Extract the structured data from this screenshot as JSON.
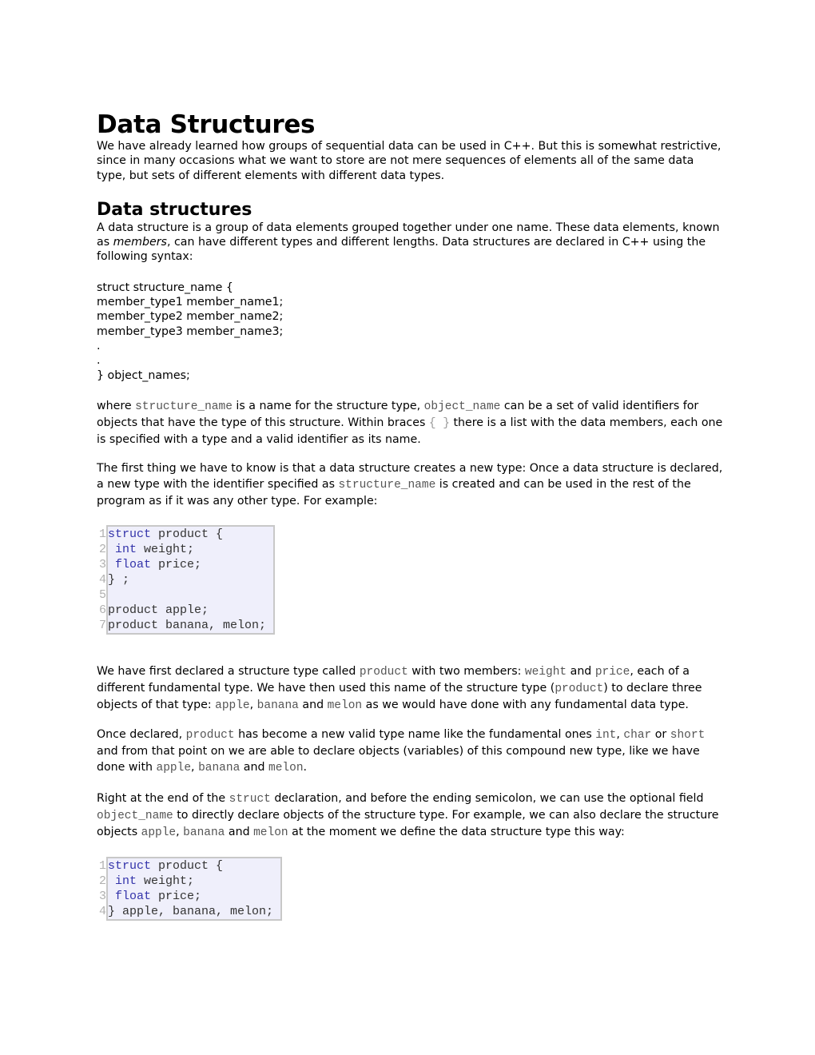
{
  "title": "Data Structures",
  "intro": "We have already learned how groups of sequential data can be used in C++. But this is somewhat restrictive, since in many occasions what we want to store are not mere sequences of elements all of the same data type, but sets of different elements with different data types.",
  "section1": {
    "heading": "Data structures",
    "para_a": "A data structure is a group of data elements grouped together under one name. These data elements, known as ",
    "para_em": "members",
    "para_b": ", can have different types and different lengths. Data structures are declared in C++ using the following syntax:"
  },
  "syntax_lines": [
    "struct structure_name {",
    "member_type1 member_name1;",
    "member_type2 member_name2;",
    "member_type3 member_name3;",
    ".",
    ".",
    "} object_names;"
  ],
  "para_where": {
    "t1": "where ",
    "c1": "structure_name",
    "t2": " is a name for the structure type, ",
    "c2": "object_name",
    "t3": " can be a set of valid identifiers for objects that have the type of this structure. Within braces ",
    "c3": "{ }",
    "t4": " there is a list with the data members, each one is specified with a type and a valid identifier as its name."
  },
  "para_first": {
    "t1": "The first thing we have to know is that a data structure creates a new type: Once a data structure is declared, a new type with the identifier specified as ",
    "c1": "structure_name",
    "t2": " is created and can be used in the rest of the program as if it was any other type. For example:"
  },
  "code1": [
    {
      "num": "1",
      "kw": "struct",
      "rest": " product {"
    },
    {
      "num": "2",
      "kw": " int",
      "rest": " weight;"
    },
    {
      "num": "3",
      "kw": " float",
      "rest": " price;"
    },
    {
      "num": "4",
      "kw": "",
      "rest": "} ;"
    },
    {
      "num": "5",
      "kw": "",
      "rest": ""
    },
    {
      "num": "6",
      "kw": "",
      "rest": "product apple;"
    },
    {
      "num": "7",
      "kw": "",
      "rest": "product banana, melon;"
    }
  ],
  "para_declared": {
    "t1": "We have first declared a structure type called ",
    "c1": "product",
    "t2": " with two members: ",
    "c2": "weight",
    "t3": " and ",
    "c3": "price",
    "t4": ", each of a different fundamental type. We have then used this name of the structure type (",
    "c4": "product",
    "t5": ") to declare three objects of that type: ",
    "c5": "apple",
    "t6": ", ",
    "c6": "banana",
    "t7": " and ",
    "c7": "melon",
    "t8": " as we would have done with any fundamental data type."
  },
  "para_once": {
    "t1": "Once declared, ",
    "c1": "product",
    "t2": " has become a new valid type name like the fundamental ones ",
    "c2": "int",
    "t3": ", ",
    "c3": "char",
    "t4": " or ",
    "c4": "short",
    "t5": " and from that point on we are able to declare objects (variables) of this compound new type, like we have done with ",
    "c5": "apple",
    "t6": ", ",
    "c6": "banana",
    "t7": " and ",
    "c7": "melon",
    "t8": "."
  },
  "para_right": {
    "t1": "Right at the end of the ",
    "c1": "struct",
    "t2": " declaration, and before the ending semicolon, we can use the optional field ",
    "c2": "object_name",
    "t3": " to directly declare objects of the structure type. For example, we can also declare the structure objects ",
    "c3": "apple",
    "t4": ", ",
    "c4": "banana",
    "t5": " and ",
    "c5": "melon",
    "t6": " at the moment we define the data structure type this way:"
  },
  "code2": [
    {
      "num": "1",
      "kw": "struct",
      "rest": " product {"
    },
    {
      "num": "2",
      "kw": " int",
      "rest": " weight;"
    },
    {
      "num": "3",
      "kw": " float",
      "rest": " price;"
    },
    {
      "num": "4",
      "kw": "",
      "rest": "} apple, banana, melon;"
    }
  ]
}
